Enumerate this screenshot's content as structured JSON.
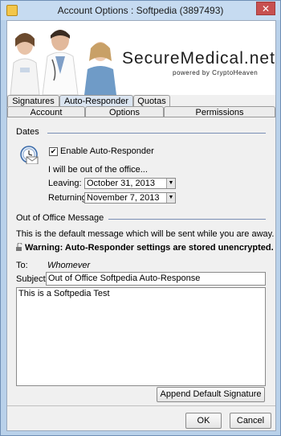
{
  "window": {
    "title": "Account Options : Softpedia (3897493)",
    "close": "✕"
  },
  "banner": {
    "brand": "SecureMedical.net",
    "powered": "powered by CryptoHeaven"
  },
  "tabs": {
    "row1": [
      {
        "label": "Signatures"
      },
      {
        "label": "Auto-Responder"
      },
      {
        "label": "Quotas"
      }
    ],
    "row2": [
      {
        "label": "Account"
      },
      {
        "label": "Options"
      },
      {
        "label": "Permissions"
      }
    ]
  },
  "dates": {
    "heading": "Dates",
    "enable_label": "Enable Auto-Responder",
    "enable_checked": "✔",
    "out_text": "I will be out of the office...",
    "leaving_label": "Leaving:",
    "leaving_value": "October 31, 2013",
    "returning_label": "Returning:",
    "returning_value": "November 7, 2013"
  },
  "message": {
    "heading": "Out of Office Message",
    "default_text": "This is the default message which will be sent while you are away.",
    "warning": "Warning: Auto-Responder settings are stored unencrypted.",
    "to_label": "To:",
    "to_value": "Whomever",
    "subject_label": "Subject:",
    "subject_value": "Out of Office Softpedia Auto-Response",
    "body": "This is a Softpedia Test"
  },
  "buttons": {
    "append": "Append Default Signature",
    "ok": "OK",
    "cancel": "Cancel"
  }
}
